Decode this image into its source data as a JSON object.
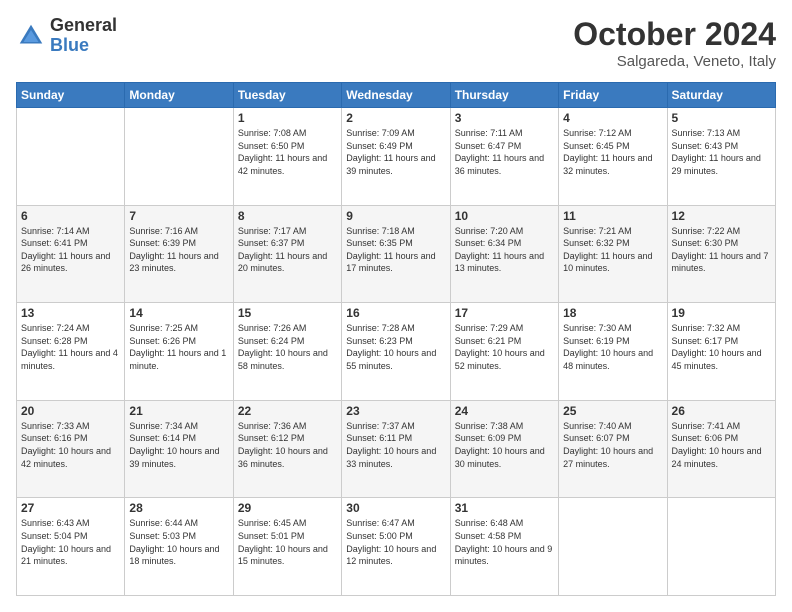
{
  "header": {
    "logo_general": "General",
    "logo_blue": "Blue",
    "month_title": "October 2024",
    "location": "Salgareda, Veneto, Italy"
  },
  "days_of_week": [
    "Sunday",
    "Monday",
    "Tuesday",
    "Wednesday",
    "Thursday",
    "Friday",
    "Saturday"
  ],
  "weeks": [
    [
      {
        "day": "",
        "sunrise": "",
        "sunset": "",
        "daylight": ""
      },
      {
        "day": "",
        "sunrise": "",
        "sunset": "",
        "daylight": ""
      },
      {
        "day": "1",
        "sunrise": "Sunrise: 7:08 AM",
        "sunset": "Sunset: 6:50 PM",
        "daylight": "Daylight: 11 hours and 42 minutes."
      },
      {
        "day": "2",
        "sunrise": "Sunrise: 7:09 AM",
        "sunset": "Sunset: 6:49 PM",
        "daylight": "Daylight: 11 hours and 39 minutes."
      },
      {
        "day": "3",
        "sunrise": "Sunrise: 7:11 AM",
        "sunset": "Sunset: 6:47 PM",
        "daylight": "Daylight: 11 hours and 36 minutes."
      },
      {
        "day": "4",
        "sunrise": "Sunrise: 7:12 AM",
        "sunset": "Sunset: 6:45 PM",
        "daylight": "Daylight: 11 hours and 32 minutes."
      },
      {
        "day": "5",
        "sunrise": "Sunrise: 7:13 AM",
        "sunset": "Sunset: 6:43 PM",
        "daylight": "Daylight: 11 hours and 29 minutes."
      }
    ],
    [
      {
        "day": "6",
        "sunrise": "Sunrise: 7:14 AM",
        "sunset": "Sunset: 6:41 PM",
        "daylight": "Daylight: 11 hours and 26 minutes."
      },
      {
        "day": "7",
        "sunrise": "Sunrise: 7:16 AM",
        "sunset": "Sunset: 6:39 PM",
        "daylight": "Daylight: 11 hours and 23 minutes."
      },
      {
        "day": "8",
        "sunrise": "Sunrise: 7:17 AM",
        "sunset": "Sunset: 6:37 PM",
        "daylight": "Daylight: 11 hours and 20 minutes."
      },
      {
        "day": "9",
        "sunrise": "Sunrise: 7:18 AM",
        "sunset": "Sunset: 6:35 PM",
        "daylight": "Daylight: 11 hours and 17 minutes."
      },
      {
        "day": "10",
        "sunrise": "Sunrise: 7:20 AM",
        "sunset": "Sunset: 6:34 PM",
        "daylight": "Daylight: 11 hours and 13 minutes."
      },
      {
        "day": "11",
        "sunrise": "Sunrise: 7:21 AM",
        "sunset": "Sunset: 6:32 PM",
        "daylight": "Daylight: 11 hours and 10 minutes."
      },
      {
        "day": "12",
        "sunrise": "Sunrise: 7:22 AM",
        "sunset": "Sunset: 6:30 PM",
        "daylight": "Daylight: 11 hours and 7 minutes."
      }
    ],
    [
      {
        "day": "13",
        "sunrise": "Sunrise: 7:24 AM",
        "sunset": "Sunset: 6:28 PM",
        "daylight": "Daylight: 11 hours and 4 minutes."
      },
      {
        "day": "14",
        "sunrise": "Sunrise: 7:25 AM",
        "sunset": "Sunset: 6:26 PM",
        "daylight": "Daylight: 11 hours and 1 minute."
      },
      {
        "day": "15",
        "sunrise": "Sunrise: 7:26 AM",
        "sunset": "Sunset: 6:24 PM",
        "daylight": "Daylight: 10 hours and 58 minutes."
      },
      {
        "day": "16",
        "sunrise": "Sunrise: 7:28 AM",
        "sunset": "Sunset: 6:23 PM",
        "daylight": "Daylight: 10 hours and 55 minutes."
      },
      {
        "day": "17",
        "sunrise": "Sunrise: 7:29 AM",
        "sunset": "Sunset: 6:21 PM",
        "daylight": "Daylight: 10 hours and 52 minutes."
      },
      {
        "day": "18",
        "sunrise": "Sunrise: 7:30 AM",
        "sunset": "Sunset: 6:19 PM",
        "daylight": "Daylight: 10 hours and 48 minutes."
      },
      {
        "day": "19",
        "sunrise": "Sunrise: 7:32 AM",
        "sunset": "Sunset: 6:17 PM",
        "daylight": "Daylight: 10 hours and 45 minutes."
      }
    ],
    [
      {
        "day": "20",
        "sunrise": "Sunrise: 7:33 AM",
        "sunset": "Sunset: 6:16 PM",
        "daylight": "Daylight: 10 hours and 42 minutes."
      },
      {
        "day": "21",
        "sunrise": "Sunrise: 7:34 AM",
        "sunset": "Sunset: 6:14 PM",
        "daylight": "Daylight: 10 hours and 39 minutes."
      },
      {
        "day": "22",
        "sunrise": "Sunrise: 7:36 AM",
        "sunset": "Sunset: 6:12 PM",
        "daylight": "Daylight: 10 hours and 36 minutes."
      },
      {
        "day": "23",
        "sunrise": "Sunrise: 7:37 AM",
        "sunset": "Sunset: 6:11 PM",
        "daylight": "Daylight: 10 hours and 33 minutes."
      },
      {
        "day": "24",
        "sunrise": "Sunrise: 7:38 AM",
        "sunset": "Sunset: 6:09 PM",
        "daylight": "Daylight: 10 hours and 30 minutes."
      },
      {
        "day": "25",
        "sunrise": "Sunrise: 7:40 AM",
        "sunset": "Sunset: 6:07 PM",
        "daylight": "Daylight: 10 hours and 27 minutes."
      },
      {
        "day": "26",
        "sunrise": "Sunrise: 7:41 AM",
        "sunset": "Sunset: 6:06 PM",
        "daylight": "Daylight: 10 hours and 24 minutes."
      }
    ],
    [
      {
        "day": "27",
        "sunrise": "Sunrise: 6:43 AM",
        "sunset": "Sunset: 5:04 PM",
        "daylight": "Daylight: 10 hours and 21 minutes."
      },
      {
        "day": "28",
        "sunrise": "Sunrise: 6:44 AM",
        "sunset": "Sunset: 5:03 PM",
        "daylight": "Daylight: 10 hours and 18 minutes."
      },
      {
        "day": "29",
        "sunrise": "Sunrise: 6:45 AM",
        "sunset": "Sunset: 5:01 PM",
        "daylight": "Daylight: 10 hours and 15 minutes."
      },
      {
        "day": "30",
        "sunrise": "Sunrise: 6:47 AM",
        "sunset": "Sunset: 5:00 PM",
        "daylight": "Daylight: 10 hours and 12 minutes."
      },
      {
        "day": "31",
        "sunrise": "Sunrise: 6:48 AM",
        "sunset": "Sunset: 4:58 PM",
        "daylight": "Daylight: 10 hours and 9 minutes."
      },
      {
        "day": "",
        "sunrise": "",
        "sunset": "",
        "daylight": ""
      },
      {
        "day": "",
        "sunrise": "",
        "sunset": "",
        "daylight": ""
      }
    ]
  ]
}
